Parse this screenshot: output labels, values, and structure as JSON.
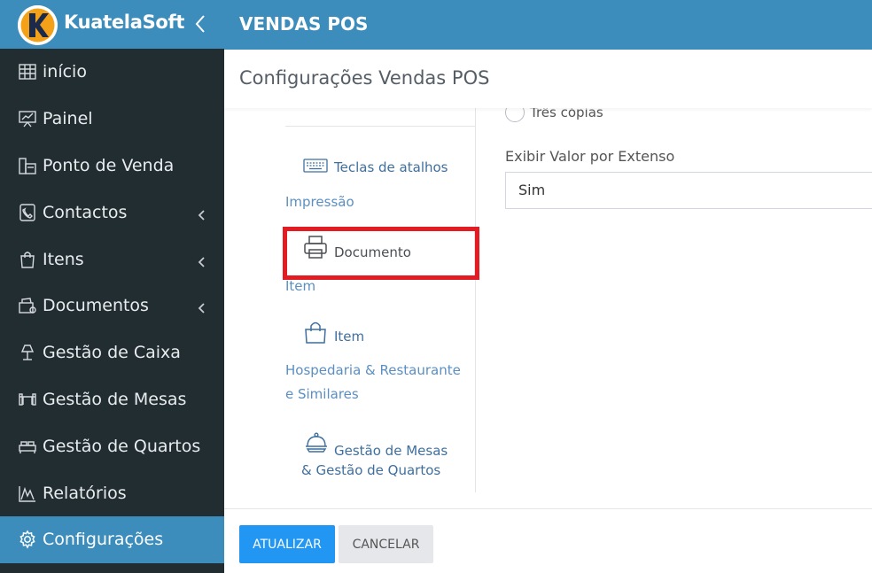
{
  "brand": {
    "name": "KuatelaSoft",
    "logo_letter": "K"
  },
  "sidebar": {
    "items": [
      {
        "label": "início",
        "icon": "dashboard-icon"
      },
      {
        "label": "Painel",
        "icon": "presentation-icon"
      },
      {
        "label": "Ponto de Venda",
        "icon": "pos-icon"
      },
      {
        "label": "Contactos",
        "icon": "contacts-icon"
      },
      {
        "label": "Itens",
        "icon": "shopping-bag-icon"
      },
      {
        "label": "Documentos",
        "icon": "documents-icon"
      },
      {
        "label": "Gestão de Caixa",
        "icon": "lamp-icon"
      },
      {
        "label": "Gestão de Mesas",
        "icon": "table-icon"
      },
      {
        "label": "Gestão de Quartos",
        "icon": "bed-icon"
      },
      {
        "label": "Relatórios",
        "icon": "chart-icon"
      },
      {
        "label": "Configurações",
        "icon": "gear-icon"
      }
    ],
    "active_index": 10
  },
  "header": {
    "title": "VENDAS POS"
  },
  "page": {
    "title": "Configurações Vendas POS"
  },
  "settings_nav": {
    "tab_shortcuts": "Teclas de atalhos",
    "group_print": "Impressão",
    "tab_document": "Documento",
    "group_item": "Item",
    "tab_item": "Item",
    "group_hospitality_line1": "Hospedaria & Restaurante",
    "group_hospitality_line2": "e Similares",
    "tab_tables_line1": "Gestão de Mesas",
    "tab_tables_line2": "& Gestão de Quartos"
  },
  "form": {
    "copies_option": "Três cópias",
    "amount_in_words_label": "Exibir Valor por Extenso",
    "amount_in_words_value": "Sim"
  },
  "actions": {
    "update": "ATUALIZAR",
    "cancel": "CANCELAR"
  },
  "colors": {
    "accent": "#3c8dbc",
    "sidebar": "#222d32",
    "primary_button": "#2196f3",
    "highlight": "#e31b23"
  }
}
